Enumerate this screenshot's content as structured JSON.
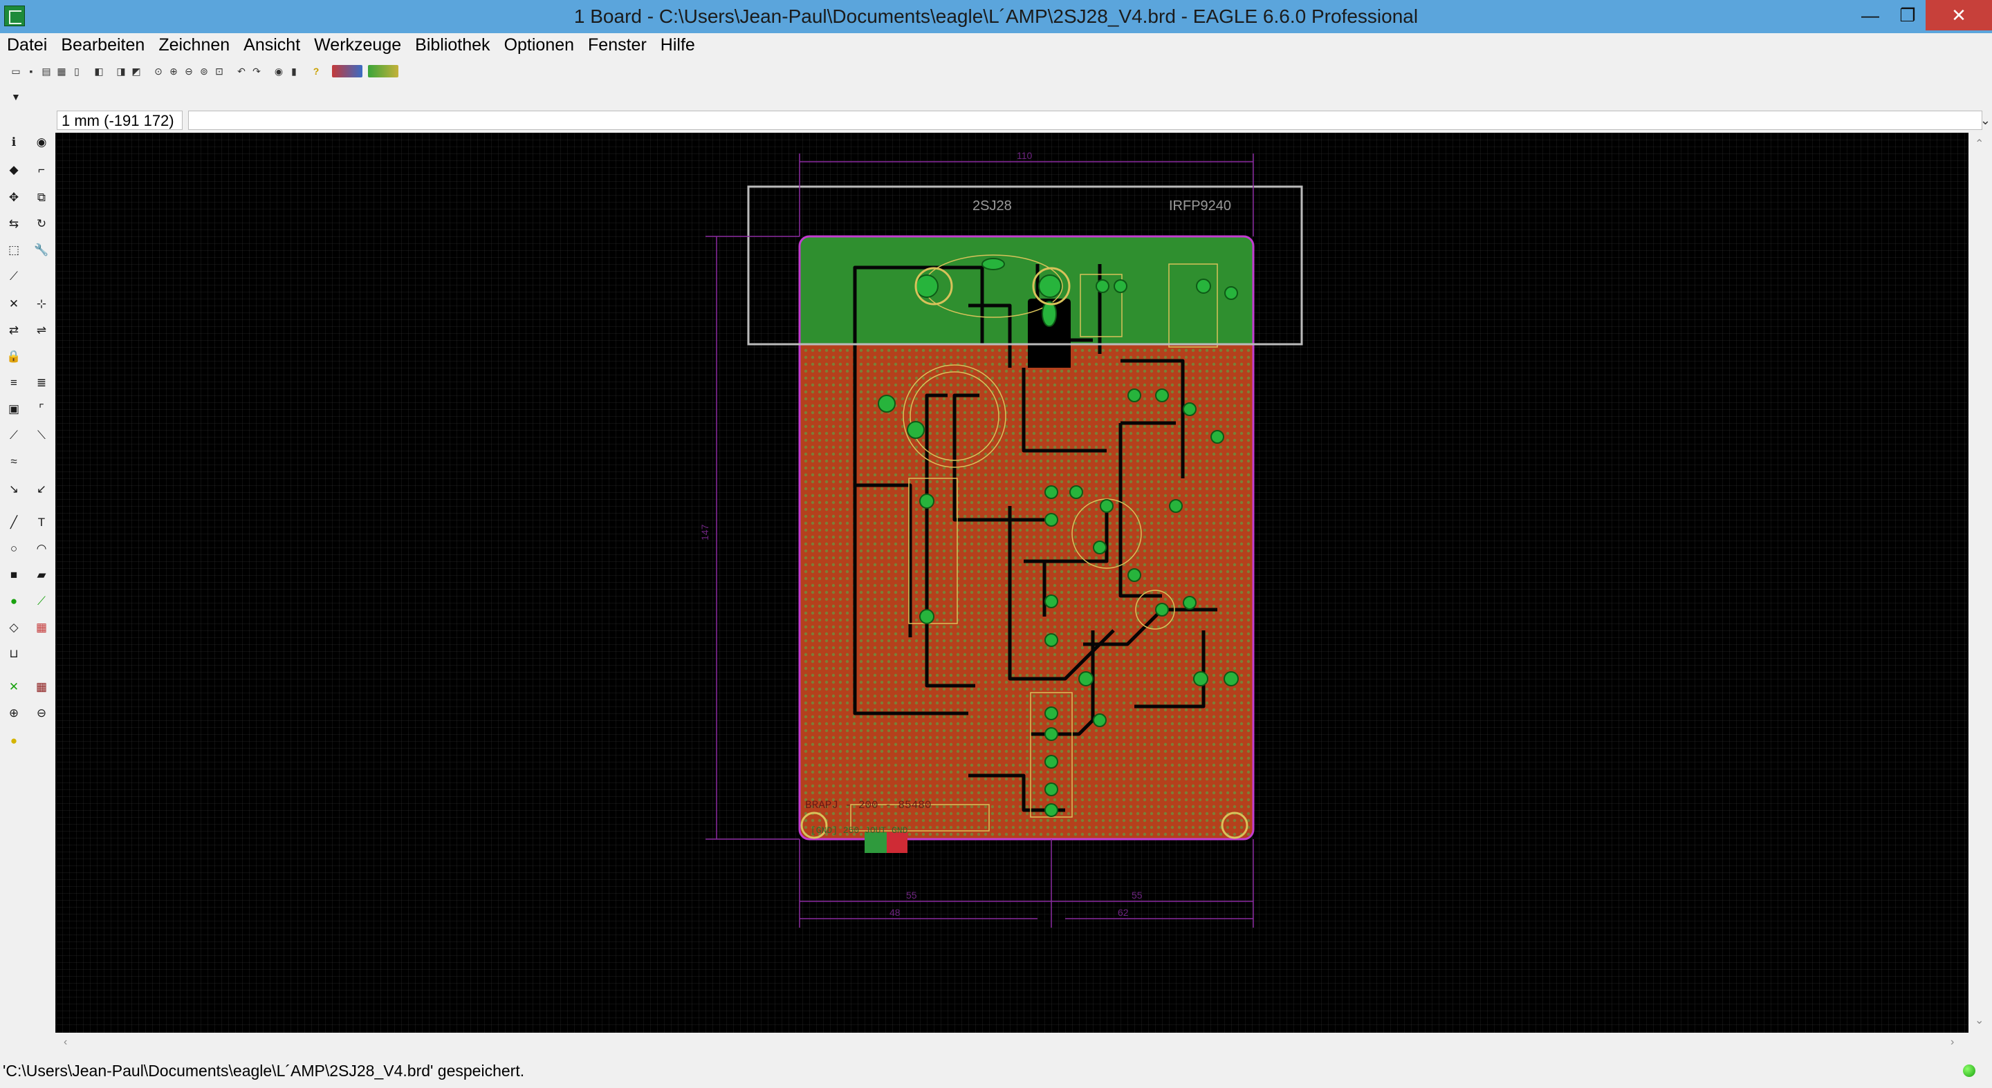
{
  "window": {
    "title": "1 Board - C:\\Users\\Jean-Paul\\Documents\\eagle\\L´AMP\\2SJ28_V4.brd - EAGLE 6.6.0 Professional",
    "minimize_glyph": "—",
    "maximize_glyph": "❐",
    "close_glyph": "✕"
  },
  "menu": [
    {
      "label": "Datei"
    },
    {
      "label": "Bearbeiten"
    },
    {
      "label": "Zeichnen"
    },
    {
      "label": "Ansicht"
    },
    {
      "label": "Werkzeuge"
    },
    {
      "label": "Bibliothek"
    },
    {
      "label": "Optionen"
    },
    {
      "label": "Fenster"
    },
    {
      "label": "Hilfe"
    }
  ],
  "toolbar": {
    "icons": [
      "open-icon",
      "save-icon",
      "print-icon",
      "cam-icon",
      "script-icon",
      "ulp-icon",
      "layer-icon",
      "layer2-icon",
      "zoom-fit-icon",
      "zoom-in-icon",
      "zoom-out-icon",
      "zoom-redraw-icon",
      "zoom-select-icon",
      "undo-icon",
      "redo-icon",
      "stop-icon",
      "go-icon",
      "help-icon",
      "design-link-icon",
      "design-block-icon"
    ],
    "help_glyph": "?"
  },
  "command_line": {
    "grid_readout": "1 mm (-191 172)",
    "value": ""
  },
  "board": {
    "parts": {
      "left": "2SJ28",
      "right": "IRFP9240"
    },
    "silk_text_1": "BRAPJ - 200 - 85480",
    "silk_text_2": "[GND] 250 JOUT GND",
    "dims": {
      "top": "110",
      "left": "147",
      "bottom_left": "55",
      "bottom_right": "55",
      "bottom_a": "48",
      "bottom_b": "62"
    },
    "colors": {
      "copper": "#b5401c",
      "polygon": "#2f8f2f",
      "outline": "#c23cd0",
      "silk": "#d8c25a",
      "pad": "#27b43c",
      "trace": "#050505"
    }
  },
  "status": {
    "text": "'C:\\Users\\Jean-Paul\\Documents\\eagle\\L´AMP\\2SJ28_V4.brd' gespeichert."
  }
}
